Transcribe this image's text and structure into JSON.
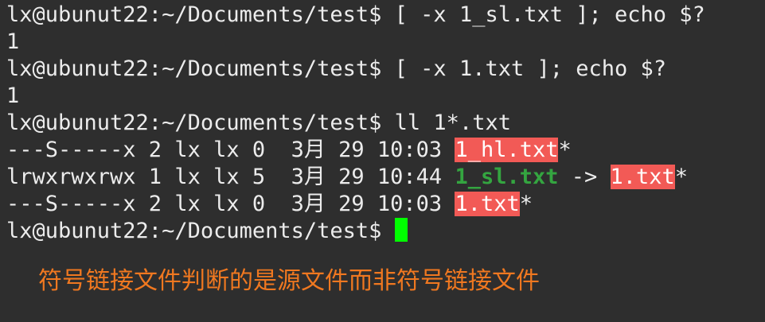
{
  "terminal": {
    "lines": [
      {
        "prompt": "lx@ubunut22:~/Documents/test$",
        "command": " [ -x 1_sl.txt ]; echo $?"
      },
      {
        "text": "1"
      },
      {
        "prompt": "lx@ubunut22:~/Documents/test$",
        "command": " [ -x 1.txt ]; echo $?"
      },
      {
        "text": "1"
      },
      {
        "prompt": "lx@ubunut22:~/Documents/test$",
        "command": " ll 1*.txt"
      }
    ],
    "listing": [
      {
        "meta": "---S-----x 2 lx lx 0  3月 29 10:03 ",
        "name": "1_hl.txt",
        "suffix": "*"
      },
      {
        "meta": "lrwxrwxrwx 1 lx lx 5  3月 29 10:44 ",
        "name": "1_sl.txt",
        "arrow": " -> ",
        "target": "1.txt",
        "suffix": "*"
      },
      {
        "meta": "---S-----x 2 lx lx 0  3月 29 10:03 ",
        "name": "1.txt",
        "suffix": "*"
      }
    ],
    "final_prompt": "lx@ubunut22:~/Documents/test$ ",
    "colors": {
      "background": "#2e2e2e",
      "text": "#ececec",
      "setuid_highlight": "#f25a56",
      "symlink": "#34a540",
      "cursor": "#00ff00",
      "caption": "#f07820"
    }
  },
  "caption": "符号链接文件判断的是源文件而非符号链接文件"
}
